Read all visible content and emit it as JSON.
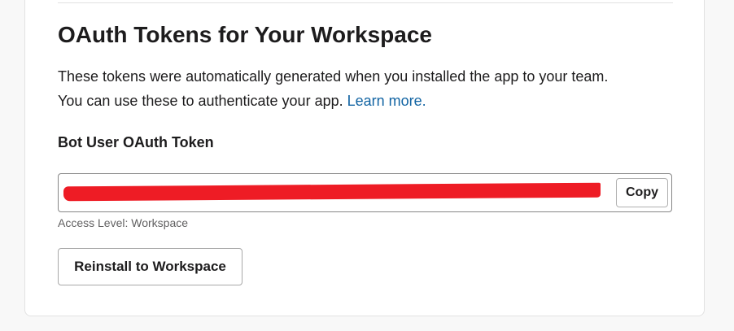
{
  "section": {
    "title": "OAuth Tokens for Your Workspace",
    "description_line1": "These tokens were automatically generated when you installed the app to your team.",
    "description_line2": "You can use these to authenticate your app.",
    "learn_more_label": "Learn more."
  },
  "bot_token": {
    "label": "Bot User OAuth Token",
    "value": "",
    "copy_label": "Copy",
    "access_level": "Access Level: Workspace"
  },
  "actions": {
    "reinstall_label": "Reinstall to Workspace"
  },
  "colors": {
    "link": "#1264a3",
    "redaction": "#ee1c25"
  }
}
